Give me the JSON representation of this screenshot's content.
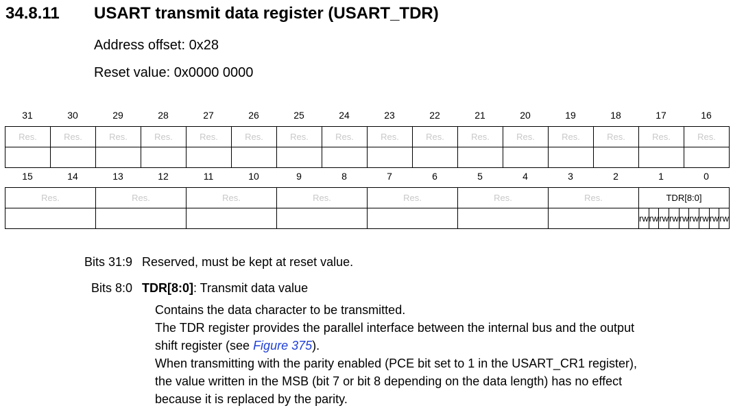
{
  "heading": {
    "number": "34.8.11",
    "title": "USART transmit data register (USART_TDR)"
  },
  "address_offset": "Address offset: 0x28",
  "reset_value": "Reset value: 0x0000 0000",
  "register": {
    "upper_bits": [
      "31",
      "30",
      "29",
      "28",
      "27",
      "26",
      "25",
      "24",
      "23",
      "22",
      "21",
      "20",
      "19",
      "18",
      "17",
      "16"
    ],
    "lower_bits": [
      "15",
      "14",
      "13",
      "12",
      "11",
      "10",
      "9",
      "8",
      "7",
      "6",
      "5",
      "4",
      "3",
      "2",
      "1",
      "0"
    ],
    "reserved_label": "Res.",
    "field_label": "TDR[8:0]",
    "access_label": "rw",
    "reserved_color": "#c8c8c8"
  },
  "bits": [
    {
      "range": "Bits 31:9",
      "text": "Reserved, must be kept at reset value."
    },
    {
      "range": "Bits 8:0",
      "name": "TDR[8:0]",
      "text": ": Transmit data value",
      "p1": "Contains the data character to be transmitted.",
      "p2_line1": "The TDR register provides the parallel interface between the internal bus and the output",
      "p2_line2_pre": "shift register (see ",
      "p2_link": "Figure 375",
      "p2_line2_post": ").",
      "p3_line1": "When transmitting with the parity enabled (PCE bit set to 1 in the USART_CR1 register),",
      "p3_line2": "the value written in the MSB (bit 7 or bit 8 depending on the data length) has no effect",
      "p3_line3": "because it is replaced by the parity."
    }
  ]
}
